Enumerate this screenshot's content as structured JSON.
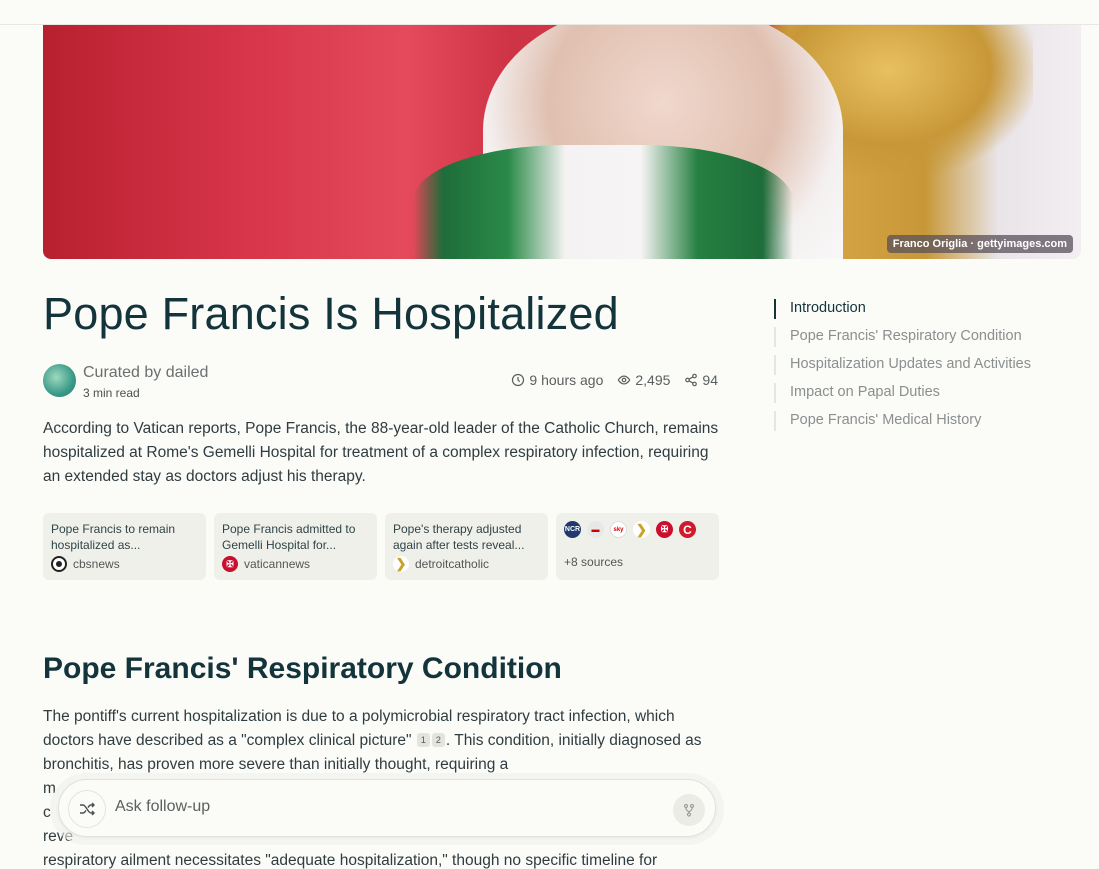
{
  "hero": {
    "image_alt": "Pope Francis portrait",
    "credit": "Franco Origlia · gettyimages.com"
  },
  "article": {
    "title": "Pope Francis Is Hospitalized",
    "curator": "Curated by dailed",
    "read_time": "3 min read",
    "time_ago": "9 hours ago",
    "views": "2,495",
    "shares": "94",
    "intro": "According to Vatican reports, Pope Francis, the 88-year-old leader of the Catholic Church, remains hospitalized at Rome's Gemelli Hospital for treatment of a complex respiratory infection, requiring an extended stay as doctors adjust his therapy."
  },
  "sources": [
    {
      "title": "Pope Francis to remain hospitalized as...",
      "site": "cbsnews",
      "icon": "cbs-eye-icon"
    },
    {
      "title": "Pope Francis admitted to Gemelli Hospital for...",
      "site": "vaticannews",
      "icon": "vatican-icon"
    },
    {
      "title": "Pope's therapy adjusted again after tests reveal...",
      "site": "detroitcatholic",
      "icon": "detroit-catholic-icon"
    }
  ],
  "more_sources": {
    "label": "+8 sources",
    "icons": [
      "ncr-icon",
      "news-icon",
      "sky-news-icon",
      "detroit-catholic-icon",
      "vatican-icon",
      "catholic-c-icon"
    ]
  },
  "section": {
    "heading": "Pope Francis' Respiratory Condition",
    "p1_a": "The pontiff's current hospitalization is due to a polymicrobial respiratory tract infection, which doctors have described as a \"complex clinical picture\"",
    "cite1": "1",
    "cite2": "2",
    "p1_b": ". This condition, initially diagnosed as bronchitis, has proven more severe than initially thought, requiring a",
    "p1_c": "m",
    "p1_d": "c",
    "p1_e": "reve",
    "p1_f": "respiratory ailment necessitates \"adequate hospitalization,\" though no specific timeline for"
  },
  "toc": [
    {
      "label": "Introduction",
      "active": true
    },
    {
      "label": "Pope Francis' Respiratory Condition",
      "active": false
    },
    {
      "label": "Hospitalization Updates and Activities",
      "active": false
    },
    {
      "label": "Impact on Papal Duties",
      "active": false
    },
    {
      "label": "Pope Francis' Medical History",
      "active": false
    }
  ],
  "followup": {
    "placeholder": "Ask follow-up"
  },
  "colors": {
    "text_primary": "#13343b",
    "background": "#fbfbf8",
    "card": "#f0f0eb"
  }
}
